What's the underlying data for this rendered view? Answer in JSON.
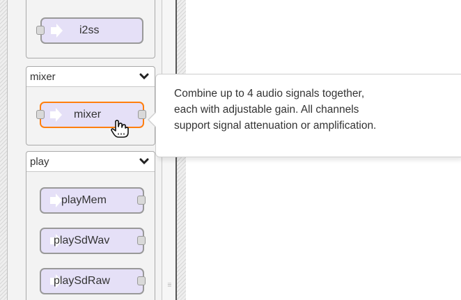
{
  "palette": {
    "categories": [
      {
        "name": "",
        "nodes": [
          {
            "label": "i2ss"
          }
        ]
      },
      {
        "name": "mixer",
        "nodes": [
          {
            "label": "mixer",
            "selected": true
          }
        ]
      },
      {
        "name": "play",
        "nodes": [
          {
            "label": "playMem"
          },
          {
            "label": "playSdWav"
          },
          {
            "label": "playSdRaw"
          }
        ]
      }
    ]
  },
  "tooltip": {
    "lines": [
      "Combine up to 4 audio signals together,",
      "each with adjustable gain. All channels",
      "support signal attenuation or amplification."
    ]
  },
  "icons": {
    "chevron": "chevron-down-icon",
    "node_arrow": "arrow-right-icon",
    "cursor": "hand-pointer-icon"
  },
  "colors": {
    "node_fill": "#e5e0f7",
    "node_border": "#999999",
    "selected_border": "#ff7f0e",
    "port_fill": "#d9d9d9"
  }
}
